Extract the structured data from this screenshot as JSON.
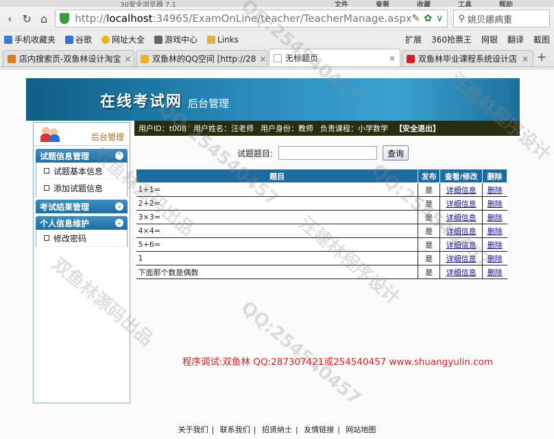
{
  "browser": {
    "title_fragment": "30安全浏览器 7.1",
    "menu_right": [
      "文件",
      "查看",
      "收藏",
      "工具",
      "帮助"
    ],
    "url": {
      "scheme": "http://",
      "host": "localhost",
      "rest": ":34965/ExamOnLine/teacher/TeacherManage.aspx"
    },
    "search_text": "姚贝娜病重",
    "bookmarks": [
      {
        "label": "手机收藏夹",
        "color": "#3a7bd5"
      },
      {
        "label": "谷歌",
        "color": "#3a6fd8"
      },
      {
        "label": "网址大全",
        "color": "#e6b422"
      },
      {
        "label": "游戏中心",
        "color": "#666"
      },
      {
        "label": "Links",
        "color": "#e0b040"
      }
    ],
    "bookmarks_right": [
      "扩展",
      "360抢票王",
      "网银",
      "翻译",
      "截图"
    ],
    "tabs": [
      {
        "label": "店内搜索页-双鱼林设计淘宝",
        "color": "#e07b20"
      },
      {
        "label": "双鱼林的QQ空间 [http://28",
        "color": "#f2b02a"
      },
      {
        "label": "无标题页",
        "color": "#ddd"
      },
      {
        "label": "双鱼林毕业课程系统设计店",
        "color": "#c22"
      }
    ]
  },
  "site": {
    "name": "在线考试网",
    "subtitle": "后台管理",
    "user_info": {
      "id": "用户ID：t008",
      "name": "用户姓名：汪老师",
      "role": "用户身份：教师",
      "course": "负责课程：小学数学",
      "logout": "【安全退出】"
    },
    "sidebar": {
      "title": "后台管理",
      "groups": [
        {
          "label": "试题信息管理",
          "items": [
            "试题基本信息",
            "添加试题信息"
          ]
        },
        {
          "label": "考试结果管理",
          "items": []
        },
        {
          "label": "个人信息维护",
          "items": [
            "修改密码"
          ]
        }
      ]
    },
    "search": {
      "label": "试题题目:",
      "value": "",
      "button": "查询"
    },
    "table": {
      "headers": [
        "题目",
        "发布",
        "查看/修改",
        "删除"
      ],
      "rows": [
        {
          "title": "1+1=",
          "published": "是",
          "view": "详细信息",
          "del": "删除"
        },
        {
          "title": "2+2=",
          "published": "是",
          "view": "详细信息",
          "del": "删除"
        },
        {
          "title": "3×3=",
          "published": "是",
          "view": "详细信息",
          "del": "删除"
        },
        {
          "title": "4×4=",
          "published": "是",
          "view": "详细信息",
          "del": "删除"
        },
        {
          "title": "5+6=",
          "published": "是",
          "view": "详细信息",
          "del": "删除"
        },
        {
          "title": "1",
          "published": "是",
          "view": "详细信息",
          "del": "删除"
        },
        {
          "title": "下面那个数是偶数",
          "published": "是",
          "view": "详细信息",
          "del": "删除"
        }
      ]
    },
    "debug_text": "程序调试:双鱼林 QQ:287307421或254540457 www.shuangyulin.com",
    "footer": [
      "关于我们",
      "联系我们",
      "招贤纳士",
      "友情链接",
      "网站地图"
    ]
  },
  "watermark": {
    "texts": [
      "QQ:254540457",
      "汪建林程序设计",
      "双鱼林源码出品"
    ]
  }
}
